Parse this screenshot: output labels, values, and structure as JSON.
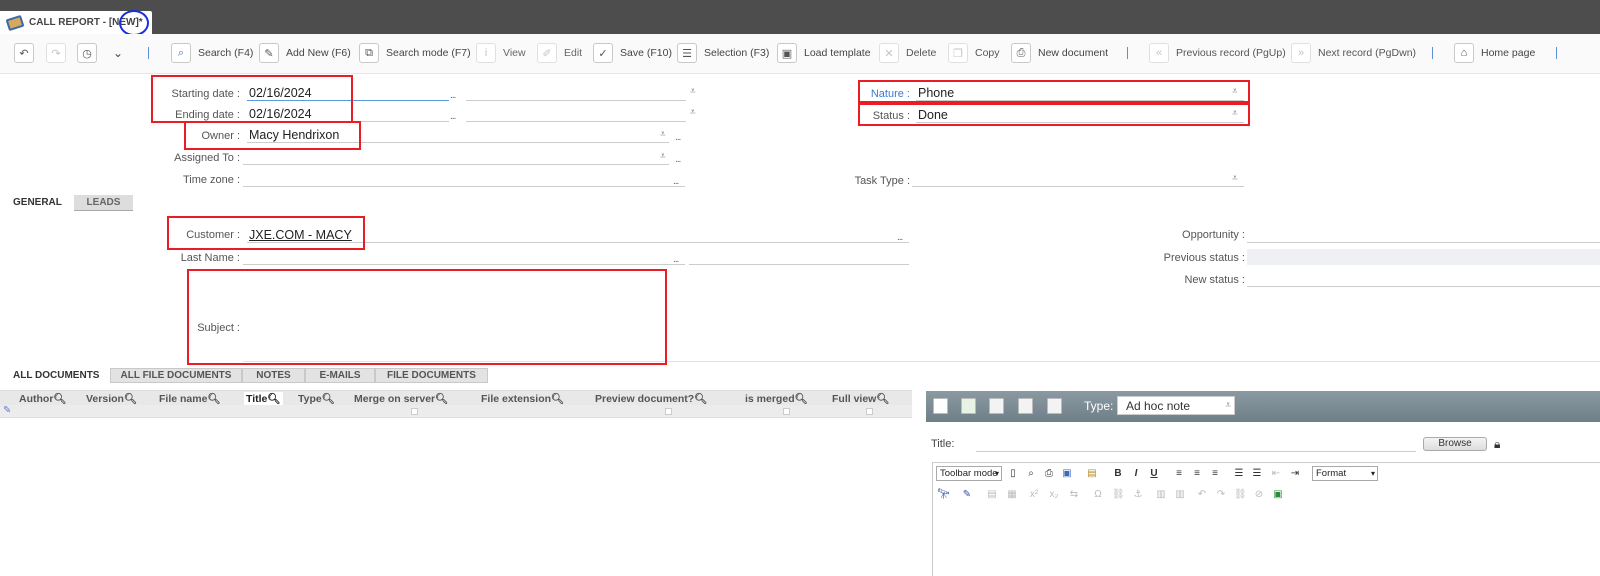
{
  "window": {
    "title": "CALL REPORT - [NEW]*"
  },
  "toolbar": {
    "items": [
      {
        "label": "Search (F4)",
        "icon": "search-icon"
      },
      {
        "label": "Add New (F6)",
        "icon": "add-new-icon"
      },
      {
        "label": "Search mode (F7)",
        "icon": "search-mode-icon"
      },
      {
        "label": "View",
        "icon": "info-icon"
      },
      {
        "label": "Edit",
        "icon": "edit-icon"
      },
      {
        "label": "Save (F10)",
        "icon": "checkmark-icon"
      },
      {
        "label": "Selection (F3)",
        "icon": "list-icon"
      },
      {
        "label": "Load template",
        "icon": "template-icon"
      },
      {
        "label": "Delete",
        "icon": "delete-icon"
      },
      {
        "label": "Copy",
        "icon": "copy-icon"
      },
      {
        "label": "New document",
        "icon": "new-document-icon"
      },
      {
        "label": "Previous record (PgUp)",
        "icon": "double-chevron-left-icon"
      },
      {
        "label": "Next record (PgDwn)",
        "icon": "double-chevron-right-icon"
      },
      {
        "label": "Home page",
        "icon": "home-icon"
      }
    ]
  },
  "form": {
    "starting_date_label": "Starting date :",
    "starting_date": "02/16/2024",
    "ending_date_label": "Ending date :",
    "ending_date": "02/16/2024",
    "owner_label": "Owner :",
    "owner": "Macy Hendrixon",
    "assigned_to_label": "Assigned To :",
    "assigned_to": "",
    "time_zone_label": "Time zone :",
    "time_zone": "",
    "nature_label": "Nature :",
    "nature": "Phone",
    "status_label": "Status :",
    "status": "Done",
    "task_type_label": "Task Type :",
    "task_type": "",
    "ellipsis": "...",
    "dropdown_glyph": "⩡"
  },
  "section_tabs": {
    "general": "GENERAL",
    "leads": "LEADS"
  },
  "general": {
    "customer_label": "Customer :",
    "customer": "JXE.COM - MACY",
    "last_name_label": "Last Name :",
    "last_name": "",
    "subject_label": "Subject :",
    "subject": "",
    "opportunity_label": "Opportunity :",
    "previous_status_label": "Previous status :",
    "new_status_label": "New status :"
  },
  "documents": {
    "tabs": [
      "ALL DOCUMENTS",
      "ALL FILE DOCUMENTS",
      "NOTES",
      "E-MAILS",
      "FILE DOCUMENTS"
    ],
    "columns": [
      "Author",
      "Version",
      "File name",
      "Title",
      "Type",
      "Merge on server",
      "File extension",
      "Preview document?",
      "is merged",
      "Full view"
    ]
  },
  "note_panel": {
    "type_label": "Type:",
    "type_value": "Ad hoc note",
    "title_label": "Title:",
    "browse_label": "Browse",
    "toolbar_mode_label": "Toolbar mode",
    "format_label": "Format"
  }
}
